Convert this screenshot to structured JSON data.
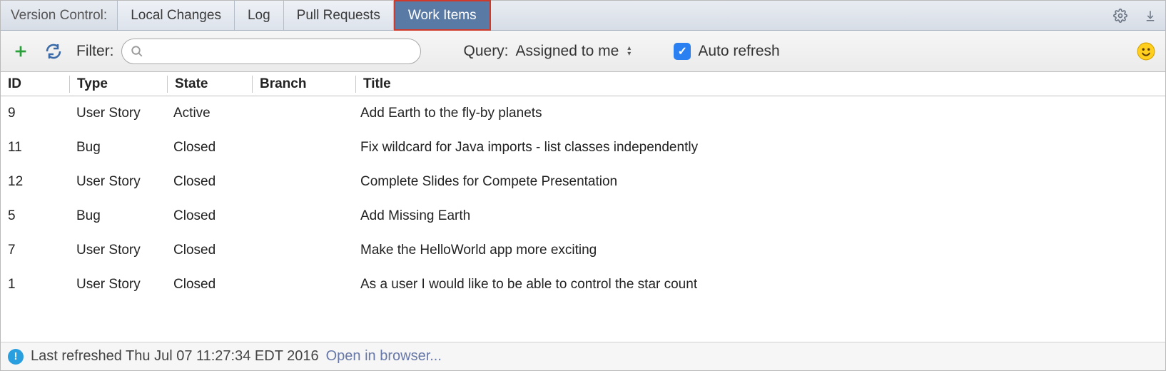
{
  "header": {
    "title": "Version Control:",
    "tabs": [
      {
        "label": "Local Changes"
      },
      {
        "label": "Log"
      },
      {
        "label": "Pull Requests"
      },
      {
        "label": "Work Items",
        "active": true
      }
    ]
  },
  "toolbar": {
    "filter_label": "Filter:",
    "search_value": "",
    "query_label": "Query:",
    "query_value": "Assigned to me",
    "autorefresh_label": "Auto refresh",
    "autorefresh_checked": true
  },
  "table": {
    "columns": [
      "ID",
      "Type",
      "State",
      "Branch",
      "Title"
    ],
    "rows": [
      {
        "id": "9",
        "type": "User Story",
        "state": "Active",
        "branch": "",
        "title": "Add Earth to the fly-by planets"
      },
      {
        "id": "11",
        "type": "Bug",
        "state": "Closed",
        "branch": "",
        "title": "Fix wildcard for Java imports - list classes independently"
      },
      {
        "id": "12",
        "type": "User Story",
        "state": "Closed",
        "branch": "",
        "title": "Complete Slides for Compete Presentation"
      },
      {
        "id": "5",
        "type": "Bug",
        "state": "Closed",
        "branch": "",
        "title": "Add Missing Earth"
      },
      {
        "id": "7",
        "type": "User Story",
        "state": "Closed",
        "branch": "",
        "title": "Make the HelloWorld app more exciting"
      },
      {
        "id": "1",
        "type": "User Story",
        "state": "Closed",
        "branch": "",
        "title": "As a user I would like to be able to control the star count"
      }
    ]
  },
  "status": {
    "text": "Last refreshed Thu Jul 07 11:27:34 EDT 2016",
    "link": "Open in browser..."
  }
}
